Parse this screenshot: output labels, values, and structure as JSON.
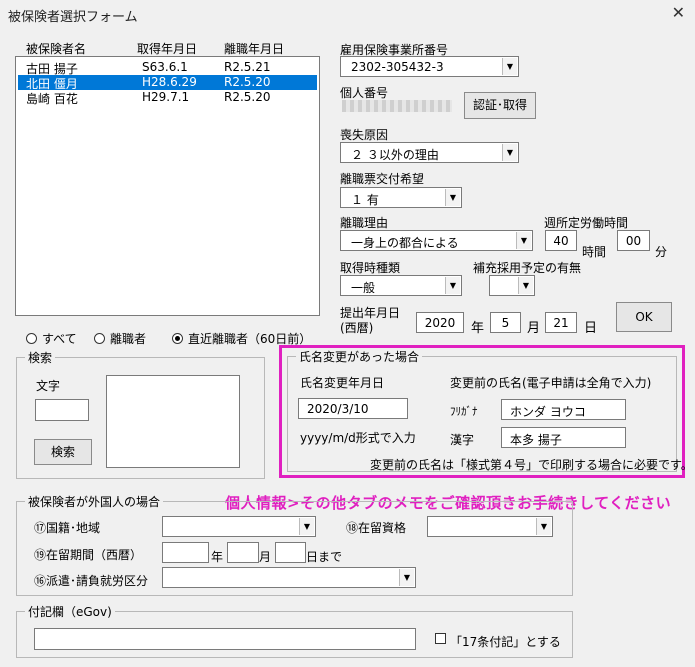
{
  "window": {
    "title": "被保険者選択フォーム",
    "close_label": "✕"
  },
  "list": {
    "headers": [
      "被保険者名",
      "取得年月日",
      "離職年月日"
    ],
    "rows": [
      {
        "name": "古田 揚子",
        "acquired": "S63.6.1",
        "separated": "R2.5.21",
        "selected": false
      },
      {
        "name": "北田 僵月",
        "acquired": "H28.6.29",
        "separated": "R2.5.20",
        "selected": true
      },
      {
        "name": "島崎 百花",
        "acquired": "H29.7.1",
        "separated": "R2.5.20",
        "selected": false
      }
    ]
  },
  "filter": {
    "options": [
      "すべて",
      "離職者",
      "直近離職者（60日前）"
    ],
    "selected": "直近離職者（60日前）"
  },
  "search": {
    "legend": "検索",
    "text_label": "文字",
    "text_value": "",
    "button_label": "検索"
  },
  "office": {
    "label": "雇用保険事業所番号",
    "value": "2302-305432-3"
  },
  "personal_number": {
    "label": "個人番号",
    "button_label": "認証･取得"
  },
  "loss_reason": {
    "label": "喪失原因",
    "value": "２ ３以外の理由"
  },
  "separation_slip": {
    "label": "離職票交付希望",
    "value": "１ 有"
  },
  "separation_reason": {
    "label": "離職理由",
    "value": "一身上の都合による"
  },
  "weekly_hours": {
    "label": "週所定労働時間",
    "hours": "40",
    "hours_unit": "時間",
    "minutes": "00",
    "minutes_unit": "分"
  },
  "acquisition_type": {
    "label": "取得時種類",
    "value": "一般"
  },
  "replacement": {
    "label": "補充採用予定の有無",
    "value": ""
  },
  "submission": {
    "label_line1": "提出年月日",
    "label_line2": "(西暦)",
    "year": "2020",
    "year_unit": "年",
    "month": "5",
    "month_unit": "月",
    "day": "21",
    "day_unit": "日"
  },
  "ok_button": "OK",
  "name_change": {
    "legend": "氏名変更があった場合",
    "date_label": "氏名変更年月日",
    "date_value": "2020/3/10",
    "format_hint": "yyyy/m/d形式で入力",
    "prev_name_label": "変更前の氏名(電子申請は全角で入力)",
    "furigana_label": "ﾌﾘｶﾞﾅ",
    "furigana_value": "ホンダ ヨウコ",
    "kanji_label": "漢字",
    "kanji_value": "本多 揚子",
    "note": "変更前の氏名は「様式第４号」で印刷する場合に必要です。"
  },
  "notice": "個人情報>その他タブのメモをご確認頂きお手続きしてください",
  "foreigner": {
    "legend": "被保険者が外国人の場合",
    "nationality_label": "⑰国籍･地域",
    "status_label": "⑱在留資格",
    "period_label": "⑲在留期間（西暦）",
    "year_unit": "年",
    "month_unit": "月",
    "until_label": "日まで",
    "dispatch_label": "⑯派遣･請負就労区分"
  },
  "remarks": {
    "legend": "付記欄（eGov)",
    "value": "",
    "checkbox_label": "「17条付記」とする"
  },
  "colors": {
    "selection": "#0078d7",
    "highlight_border": "#e020c0",
    "notice_text": "#e020c0"
  }
}
